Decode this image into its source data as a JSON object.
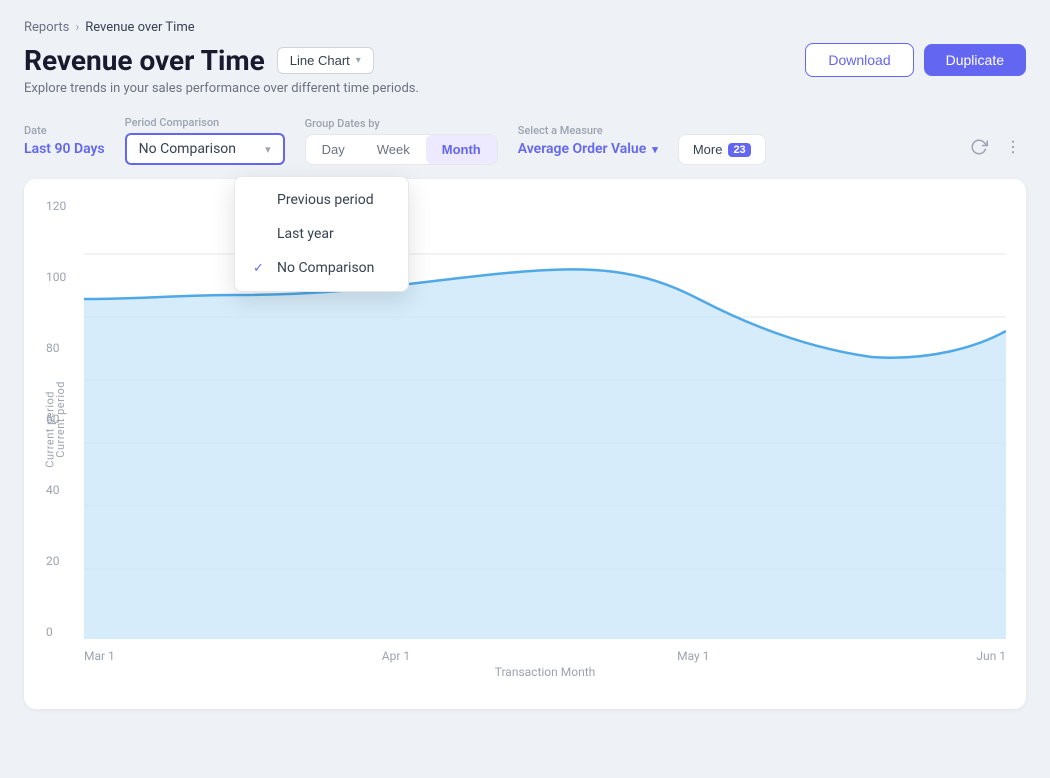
{
  "breadcrumb": {
    "parent": "Reports",
    "separator": "›",
    "current": "Revenue over Time"
  },
  "header": {
    "title": "Revenue over Time",
    "chart_type_label": "Line Chart",
    "subtitle": "Explore trends in your sales performance over different time periods.",
    "download_label": "Download",
    "duplicate_label": "Duplicate"
  },
  "filters": {
    "date": {
      "label": "Date",
      "value": "Last 90 Days"
    },
    "period_comparison": {
      "label": "Period Comparison",
      "selected": "No Comparison",
      "options": [
        {
          "label": "Previous period",
          "selected": false
        },
        {
          "label": "Last year",
          "selected": false
        },
        {
          "label": "No Comparison",
          "selected": true
        }
      ]
    },
    "group_dates": {
      "label": "Group Dates by",
      "options": [
        "Day",
        "Week",
        "Month"
      ],
      "active": "Month"
    },
    "measure": {
      "label": "Select a Measure",
      "value": "Average Order Value"
    },
    "more": {
      "label": "More",
      "count": "23"
    }
  },
  "chart": {
    "y_axis_label": "Current period",
    "x_axis_label": "Transaction Month",
    "x_ticks": [
      "Mar 1",
      "Apr 1",
      "May 1",
      "Jun 1"
    ],
    "y_ticks": [
      "0",
      "20",
      "40",
      "60",
      "80",
      "100",
      "120"
    ],
    "colors": {
      "line": "#4fa8e8",
      "fill": "#c8e6f8",
      "grid": "#e5e7eb"
    }
  }
}
